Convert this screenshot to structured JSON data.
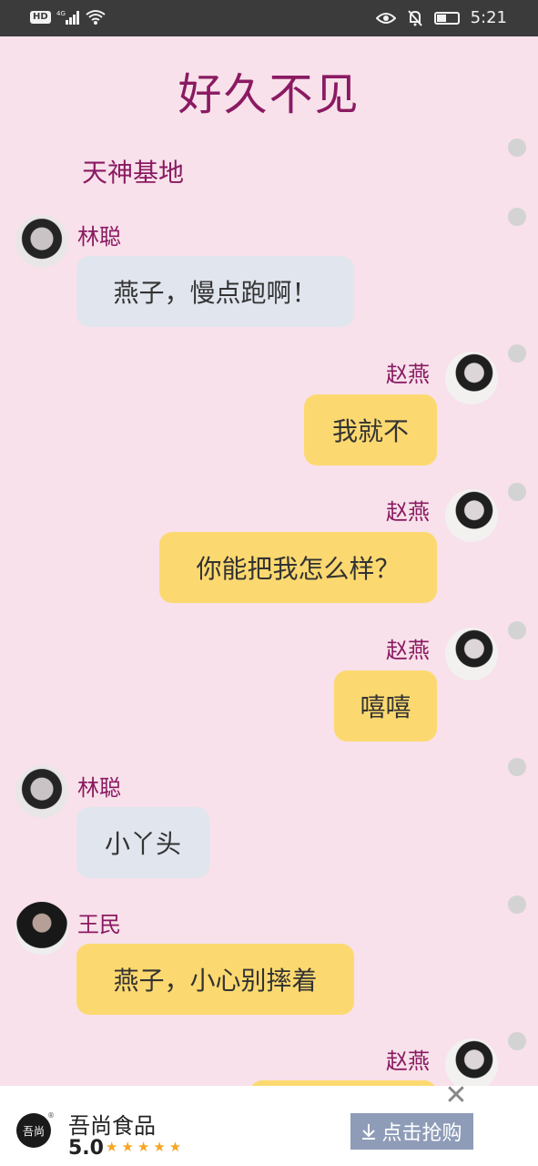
{
  "status_bar": {
    "hd_badge": "HD",
    "signal_label": "4G",
    "time": "5:21",
    "icons": [
      "signal-icon",
      "wifi-icon",
      "eye-icon",
      "bell-off-icon",
      "battery-icon"
    ]
  },
  "chat": {
    "title": "好久不见",
    "group_name": "天神基地",
    "messages": [
      {
        "sender": "林聪",
        "text": "燕子，慢点跑啊！",
        "side": "left"
      },
      {
        "sender": "赵燕",
        "text": "我就不",
        "side": "right"
      },
      {
        "sender": "赵燕",
        "text": "你能把我怎么样？",
        "side": "right"
      },
      {
        "sender": "赵燕",
        "text": "嘻嘻",
        "side": "right"
      },
      {
        "sender": "林聪",
        "text": "小丫头",
        "side": "left"
      },
      {
        "sender": "王民",
        "text": "燕子，小心别摔着",
        "side": "left"
      },
      {
        "sender": "赵燕",
        "text": "",
        "side": "right"
      }
    ]
  },
  "ad": {
    "logo_text": "吾尚",
    "registered_mark": "®",
    "name": "吾尚食品",
    "rating": "5.0",
    "stars": "★★★★★",
    "close_symbol": "✕",
    "button_label": "点击抢购",
    "button_icon": "download-arrow-icon"
  },
  "colors": {
    "background": "#f8e1ea",
    "title": "#8a1a62",
    "left_bubble": "#e1e5ee",
    "right_bubble": "#fcd970",
    "status_bar": "#3b3b3b",
    "ad_button": "#8e9cb8"
  }
}
